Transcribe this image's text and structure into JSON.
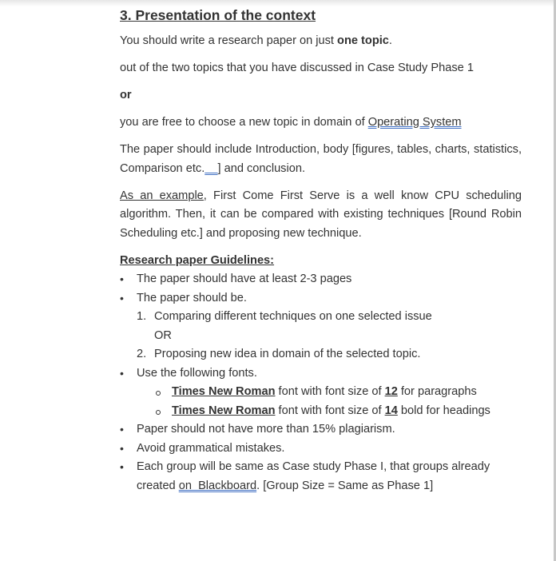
{
  "heading": "3. Presentation of the context",
  "para1": {
    "text": "You should write a research paper on just ",
    "bold": "one topic",
    "end": "."
  },
  "para2": "out of the two topics that you have discussed in Case Study Phase 1",
  "para3": "or",
  "para4": {
    "text": "you are free to choose a new topic in domain of ",
    "link": "Operating System"
  },
  "para5": {
    "text": "The paper should include Introduction, body [figures, tables, charts, statistics, Comparison etc.",
    "gap": "    ",
    "end": "] and conclusion."
  },
  "para6": {
    "underlined": "As an example,",
    "text": " First Come First Serve is a well know CPU scheduling algorithm. Then, it can be compared with existing techniques [Round Robin Scheduling etc.] and proposing new technique."
  },
  "guidelines": {
    "title": "Research paper Guidelines:",
    "bullet1": "The paper should have at least 2-3 pages",
    "bullet2": "The paper should be.",
    "numbered": [
      {
        "num": "1.",
        "text": "Comparing different techniques on one selected issue"
      },
      {
        "num": "2.",
        "text": "Proposing new idea in domain of the selected topic."
      }
    ],
    "or_text": "OR",
    "bullet3": "Use the following fonts.",
    "fonts": [
      {
        "font": "Times New Roman",
        "mid": " font with font size of ",
        "size": "12",
        "end": " for paragraphs"
      },
      {
        "font": "Times New Roman",
        "mid": " font with font size of ",
        "size": "14",
        "end": " bold for headings"
      }
    ],
    "bullet4": "Paper should not have more than 15% plagiarism.",
    "bullet5": "Avoid grammatical mistakes.",
    "bullet6": {
      "text": "Each group will be same as Case study Phase I, that groups already created ",
      "link": "on  Blackboard",
      "end": ". [Group Size = Same as Phase 1]"
    }
  }
}
